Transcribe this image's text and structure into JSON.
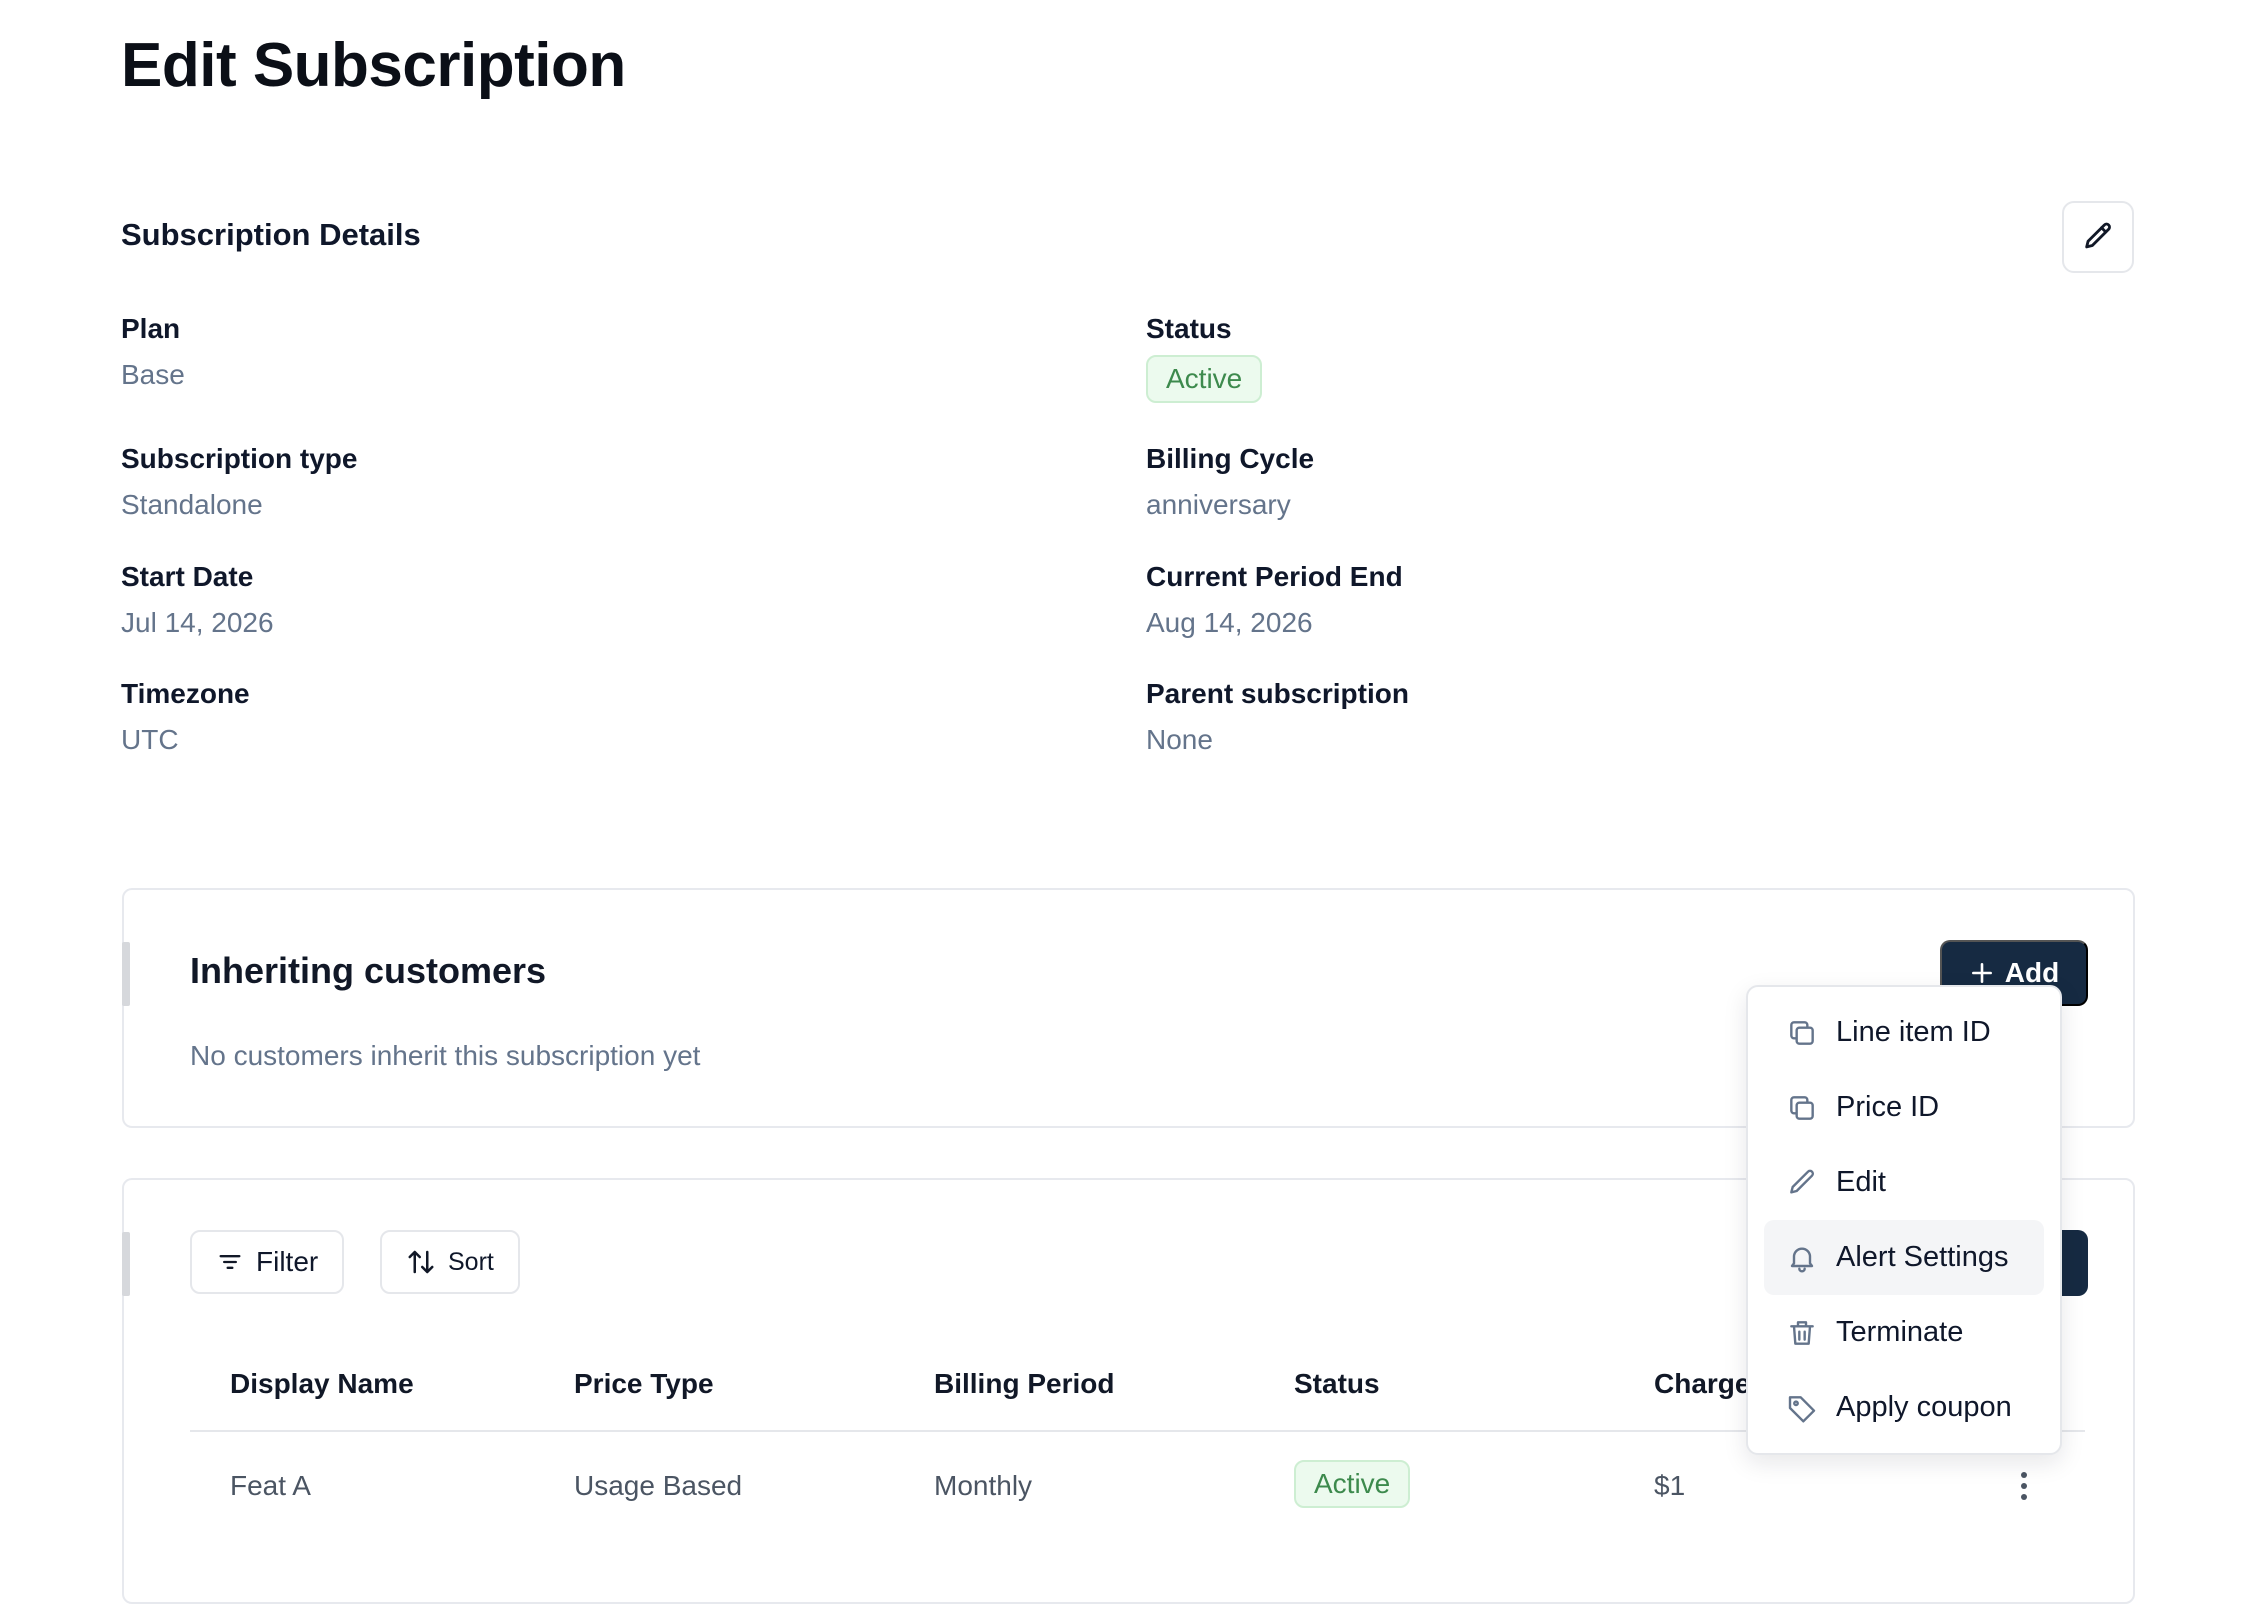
{
  "page": {
    "title": "Edit Subscription"
  },
  "details": {
    "title": "Subscription Details",
    "fields": {
      "plan": {
        "label": "Plan",
        "value": "Base"
      },
      "status": {
        "label": "Status",
        "value": "Active"
      },
      "subscription_type": {
        "label": "Subscription type",
        "value": "Standalone"
      },
      "billing_cycle": {
        "label": "Billing Cycle",
        "value": "anniversary"
      },
      "start_date": {
        "label": "Start Date",
        "value": "Jul 14, 2026"
      },
      "current_period_end": {
        "label": "Current Period End",
        "value": "Aug 14, 2026"
      },
      "timezone": {
        "label": "Timezone",
        "value": "UTC"
      },
      "parent_subscription": {
        "label": "Parent subscription",
        "value": "None"
      }
    }
  },
  "inheriting": {
    "title": "Inheriting customers",
    "empty_text": "No customers inherit this subscription yet",
    "add_label": "Add"
  },
  "line_items": {
    "filter_label": "Filter",
    "sort_label": "Sort",
    "columns": [
      "Display Name",
      "Price Type",
      "Billing Period",
      "Status",
      "Charge"
    ],
    "rows": [
      {
        "display_name": "Feat A",
        "price_type": "Usage Based",
        "billing_period": "Monthly",
        "status": "Active",
        "charge": "$1"
      }
    ]
  },
  "context_menu": {
    "items": [
      {
        "label": "Line item ID",
        "icon": "copy-icon"
      },
      {
        "label": "Price ID",
        "icon": "copy-icon"
      },
      {
        "label": "Edit",
        "icon": "pencil-icon"
      },
      {
        "label": "Alert Settings",
        "icon": "bell-icon"
      },
      {
        "label": "Terminate",
        "icon": "trash-icon"
      },
      {
        "label": "Apply coupon",
        "icon": "tag-icon"
      }
    ]
  },
  "colors": {
    "primary": "#162a42",
    "badge_bg": "#ecfaee",
    "badge_text": "#3d8a4d",
    "muted_text": "#64748b"
  }
}
